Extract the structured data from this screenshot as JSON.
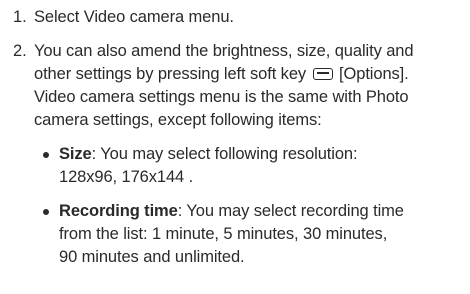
{
  "steps": [
    {
      "number": "1.",
      "lines": [
        "Select Video camera menu."
      ]
    },
    {
      "number": "2.",
      "line1": "You can also amend the brightness, size, quality and",
      "line2_before_icon": "other settings by pressing left soft key ",
      "line2_after_icon": " [Options].",
      "line3": "Video camera settings menu is the same with Photo",
      "line4": "camera settings, except following items:",
      "icon": "left-soft-key-icon"
    }
  ],
  "bullets": [
    {
      "term": "Size",
      "line1_rest": ": You may select following resolution:",
      "line2": "128x96, 176x144 ."
    },
    {
      "term": "Recording time",
      "line1_rest": ": You may select recording time",
      "line2": "from the list: 1 minute, 5 minutes, 30 minutes,",
      "line3": "90 minutes and unlimited."
    }
  ]
}
